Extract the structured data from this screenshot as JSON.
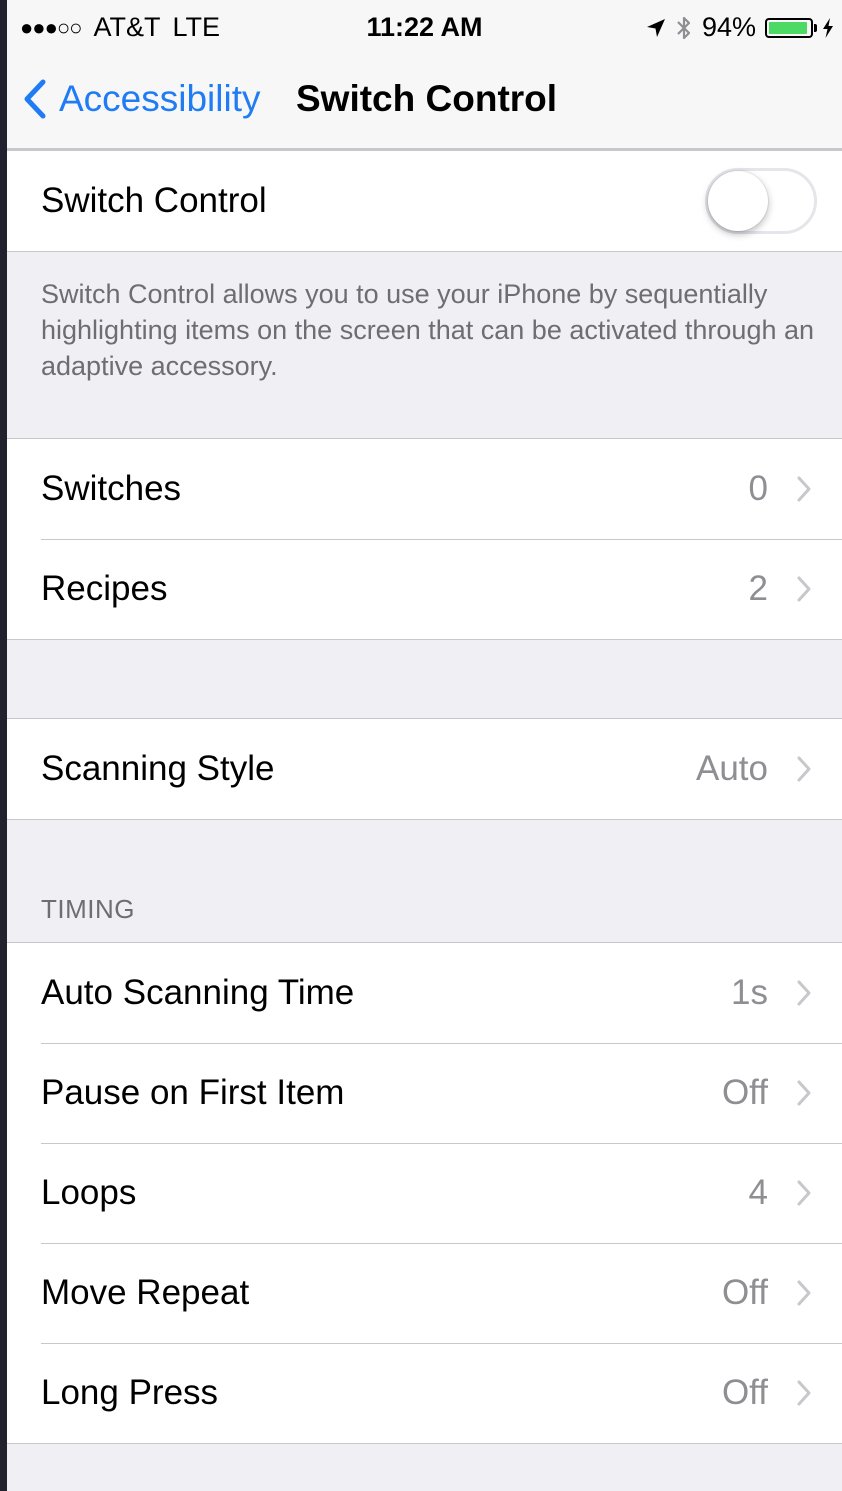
{
  "status_bar": {
    "carrier": "AT&T",
    "network": "LTE",
    "signal_glyph": "●●●○○",
    "time": "11:22 AM",
    "battery_percent": "94%",
    "battery_level": 0.94,
    "icons": [
      "location-arrow-icon",
      "bluetooth-icon",
      "battery-icon",
      "charging-bolt-icon"
    ]
  },
  "nav": {
    "back_label": "Accessibility",
    "title": "Switch Control",
    "accent_color": "#1f7cf5"
  },
  "switch_control": {
    "label": "Switch Control",
    "enabled": false,
    "description": "Switch Control allows you to use your iPhone by sequentially highlighting items on the screen that can be activated through an adaptive accessory."
  },
  "group_switches": [
    {
      "label": "Switches",
      "value": "0"
    },
    {
      "label": "Recipes",
      "value": "2"
    }
  ],
  "group_scanning": [
    {
      "label": "Scanning Style",
      "value": "Auto"
    }
  ],
  "timing": {
    "header": "TIMING",
    "rows": [
      {
        "label": "Auto Scanning Time",
        "value": "1s"
      },
      {
        "label": "Pause on First Item",
        "value": "Off"
      },
      {
        "label": "Loops",
        "value": "4"
      },
      {
        "label": "Move Repeat",
        "value": "Off"
      },
      {
        "label": "Long Press",
        "value": "Off"
      }
    ]
  }
}
